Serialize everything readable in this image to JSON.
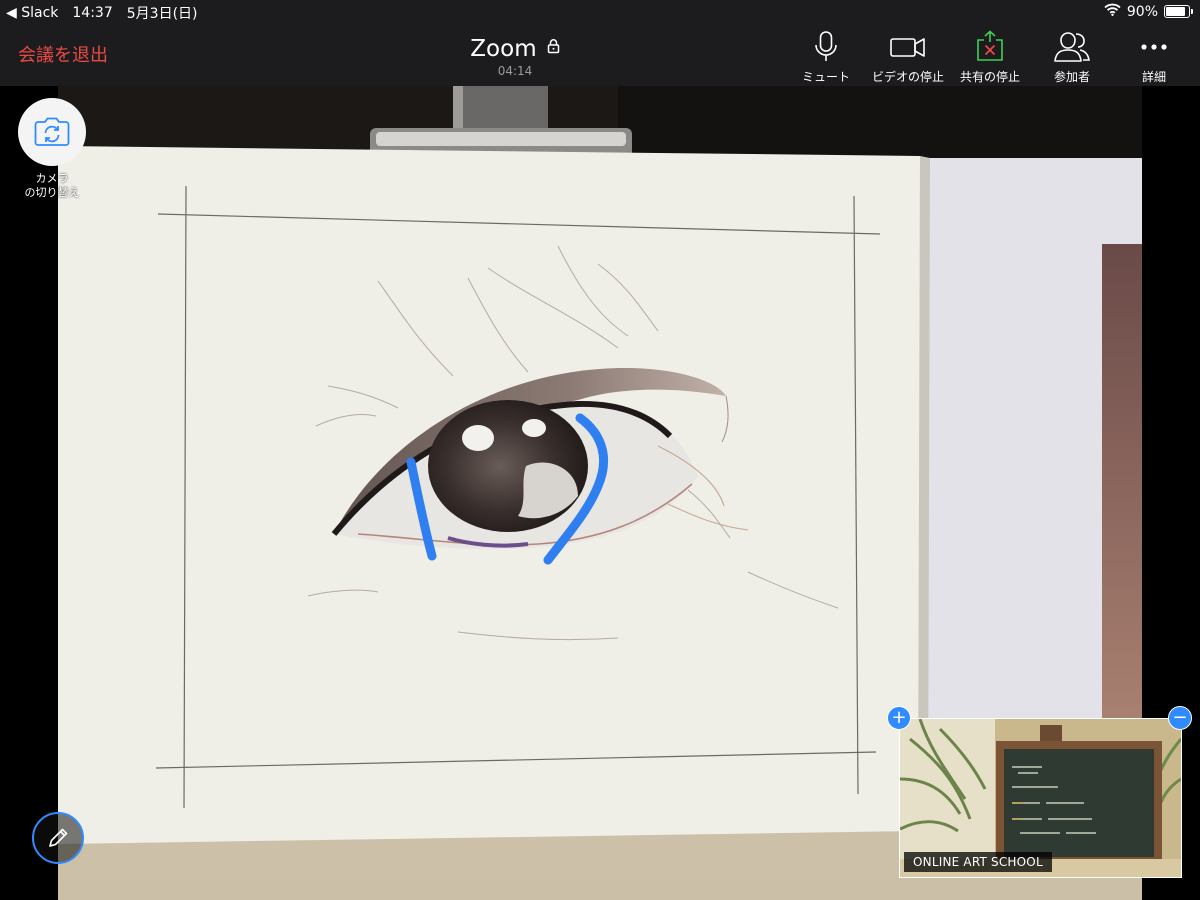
{
  "status_bar": {
    "back_app": "◀ Slack",
    "time": "14:37",
    "date": "5月3日(日)",
    "battery": "90%",
    "battery_level": 0.9
  },
  "toolbar": {
    "leave_label": "会議を退出",
    "title": "Zoom",
    "timer": "04:14",
    "mute_label": "ミュート",
    "stop_video_label": "ビデオの停止",
    "stop_share_label": "共有の停止",
    "participants_label": "参加者",
    "more_label": "詳細"
  },
  "camera_switch": {
    "label_line1": "カメラ",
    "label_line2": "の切り替え"
  },
  "self_view": {
    "name": "ONLINE ART SCHOOL",
    "expand_symbol": "+",
    "collapse_symbol": "−"
  },
  "colors": {
    "leave_red": "#e94a44",
    "share_green": "#3ecf55",
    "accent_blue": "#2f8bff",
    "toolbar_bg": "#1c1c1e",
    "annotation_blue": "#2f7ff0"
  },
  "icons": {
    "mute": "microphone-icon",
    "video": "video-camera-icon",
    "share": "share-stop-icon",
    "participants": "participants-icon",
    "more": "more-dots-icon",
    "camera": "camera-rotate-icon",
    "annotate": "pencil-icon",
    "lock": "lock-icon",
    "wifi": "wifi-icon",
    "battery": "battery-icon"
  }
}
